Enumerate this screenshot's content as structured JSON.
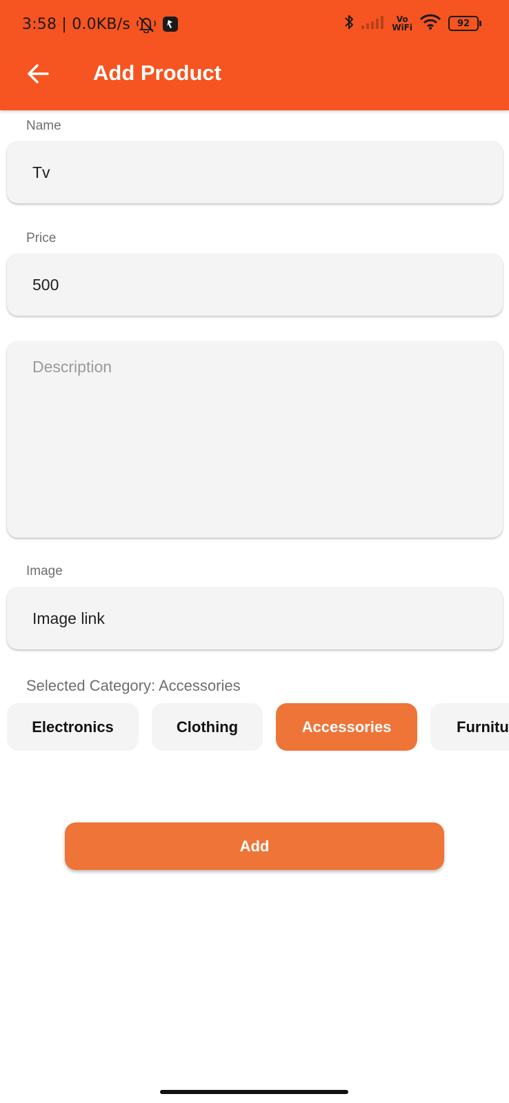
{
  "status_bar": {
    "time_and_speed": "3:58 | 0.0KB/s",
    "vo_label": "Vo",
    "wifi_label": "WiFi",
    "battery": "92",
    "icons": [
      "alarm-off-icon",
      "app-notification-icon",
      "bluetooth-icon",
      "cellular-signal-icon",
      "vowifi-icon",
      "wifi-icon",
      "battery-icon"
    ]
  },
  "toolbar": {
    "back_icon": "arrow-left-icon",
    "title": "Add Product",
    "background": "#F65420"
  },
  "form": {
    "name": {
      "label": "Name",
      "value": "Tv"
    },
    "price": {
      "label": "Price",
      "value": "500"
    },
    "description": {
      "placeholder": "Description",
      "value": ""
    },
    "image": {
      "label": "Image",
      "value": "Image link"
    }
  },
  "categories": {
    "selected_text": "Selected Category: Accessories",
    "options": [
      "Electronics",
      "Clothing",
      "Accessories",
      "Furniture"
    ],
    "selected": "Accessories",
    "accent": "#EE7438"
  },
  "actions": {
    "add_label": "Add"
  }
}
